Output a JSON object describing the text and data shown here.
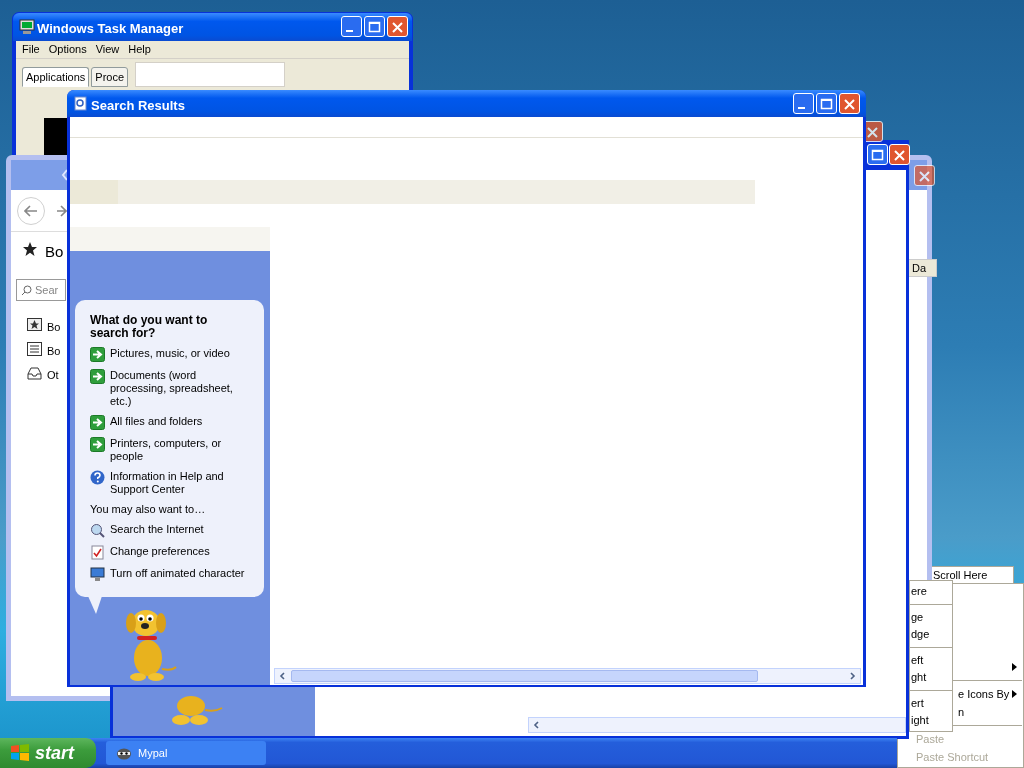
{
  "task_manager": {
    "title": "Windows Task Manager",
    "menu": [
      "File",
      "Options",
      "View",
      "Help"
    ],
    "tabs": [
      {
        "label": "Applications",
        "selected": true
      },
      {
        "label": "Proce",
        "selected": false
      }
    ]
  },
  "bookmarks_window": {
    "heading": "Bo",
    "search_placeholder": "Sear",
    "items": [
      {
        "kind": "star",
        "label": "Bo"
      },
      {
        "kind": "list",
        "label": "Bo"
      },
      {
        "kind": "tray",
        "label": "Ot"
      }
    ],
    "column_header": "Da"
  },
  "search_results": {
    "title": "Search Results",
    "question": "What do you want to search for?",
    "options": [
      {
        "kind": "arrow",
        "label": "Pictures, music, or video"
      },
      {
        "kind": "arrow",
        "label": "Documents (word processing, spreadsheet, etc.)"
      },
      {
        "kind": "arrow",
        "label": "All files and folders"
      },
      {
        "kind": "arrow",
        "label": "Printers, computers, or people"
      },
      {
        "kind": "help",
        "label": "Information in Help and Support Center"
      }
    ],
    "also_heading": "You may also want to…",
    "also": [
      {
        "kind": "internet",
        "label": "Search the Internet"
      },
      {
        "kind": "preferences",
        "label": "Change preferences"
      },
      {
        "kind": "character",
        "label": "Turn off animated character"
      }
    ]
  },
  "partial_menu": {
    "items": [
      {
        "kind": "item",
        "label": "ere"
      },
      {
        "kind": "separator"
      },
      {
        "kind": "item",
        "label": "ge"
      },
      {
        "kind": "item",
        "label": "dge"
      },
      {
        "kind": "separator"
      },
      {
        "kind": "item",
        "label": "eft"
      },
      {
        "kind": "item",
        "label": "ght"
      },
      {
        "kind": "separator"
      },
      {
        "kind": "item",
        "label": "ert"
      },
      {
        "kind": "item",
        "label": "ight"
      }
    ]
  },
  "scroll_menu": {
    "items": [
      {
        "label": "Scroll Here"
      }
    ]
  },
  "desktop_menu": {
    "items": [
      {
        "kind": "submenu",
        "disabled": false
      },
      {
        "kind": "separator"
      },
      {
        "kind": "submenu",
        "label": "e Icons By",
        "disabled": false
      },
      {
        "kind": "item",
        "label": "n",
        "disabled": false
      },
      {
        "kind": "separator"
      },
      {
        "kind": "item",
        "label": "Paste",
        "disabled": true
      },
      {
        "kind": "item",
        "label": "Paste Shortcut",
        "disabled": true
      }
    ]
  },
  "taskbar": {
    "start": "start",
    "tasks": [
      {
        "label": "Mypal",
        "selected": false
      }
    ]
  }
}
